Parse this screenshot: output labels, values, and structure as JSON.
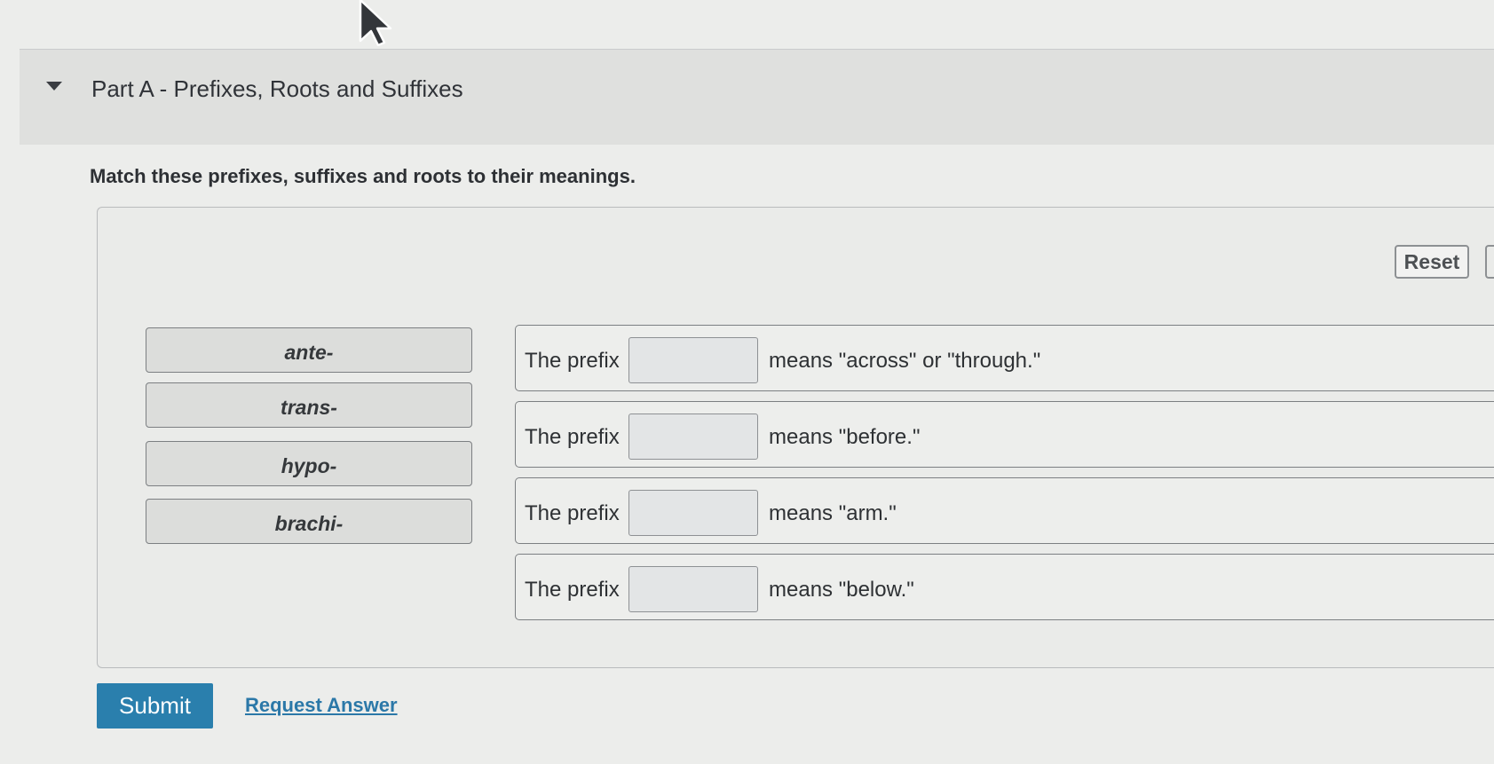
{
  "part": {
    "toggle_icon": "caret-down-icon",
    "title": "Part A - Prefixes, Roots and Suffixes"
  },
  "instructions": "Match these prefixes, suffixes and roots to their meanings.",
  "reset_label": "Reset",
  "tiles": [
    {
      "label": "ante-"
    },
    {
      "label": "trans-"
    },
    {
      "label": "hypo-"
    },
    {
      "label": "brachi-"
    }
  ],
  "rows": [
    {
      "prefix_text": "The prefix",
      "meaning": "means \"across\" or \"through.\""
    },
    {
      "prefix_text": "The prefix",
      "meaning": "means \"before.\""
    },
    {
      "prefix_text": "The prefix",
      "meaning": "means \"arm.\""
    },
    {
      "prefix_text": "The prefix",
      "meaning": "means \"below.\""
    }
  ],
  "actions": {
    "submit_label": "Submit",
    "request_answer_label": "Request Answer"
  },
  "colors": {
    "submit_bg": "#2a7fad",
    "link": "#2b78a8"
  }
}
